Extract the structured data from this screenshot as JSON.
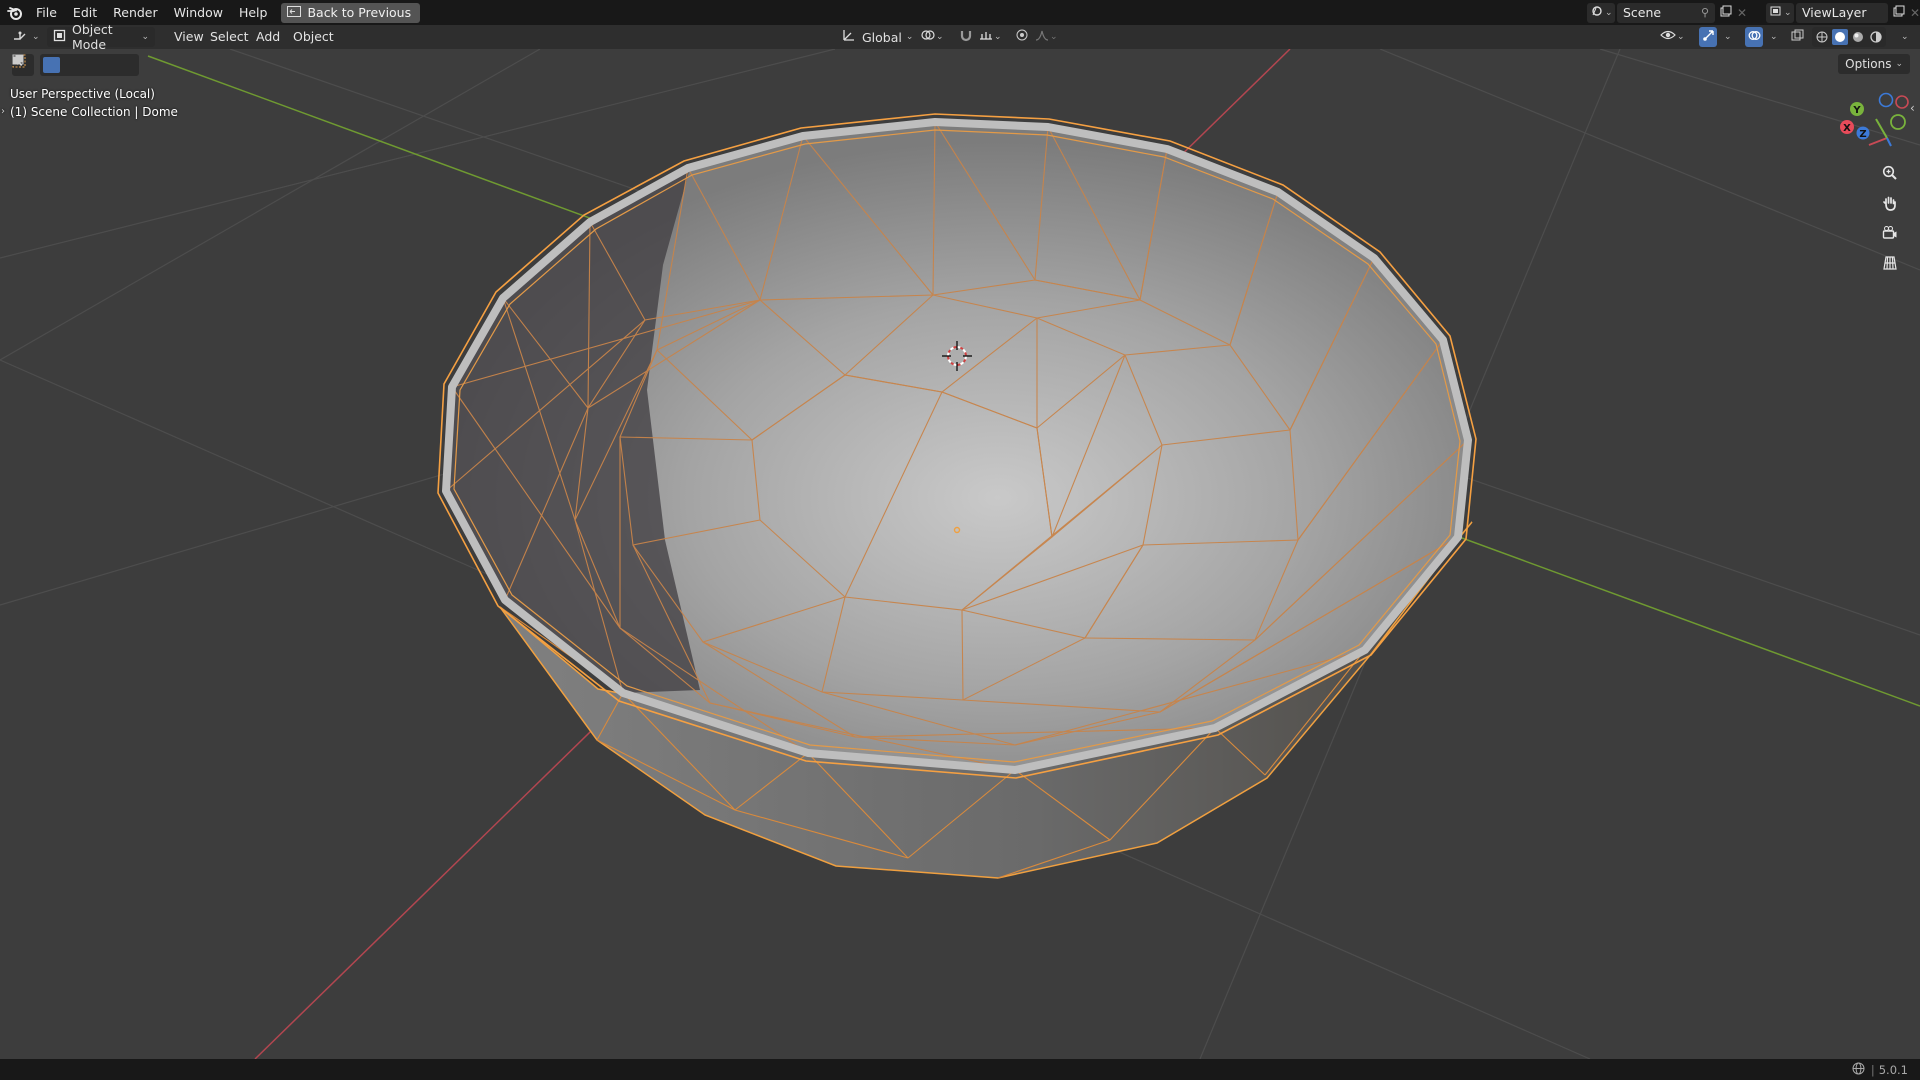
{
  "topbar": {
    "menus": [
      "File",
      "Edit",
      "Render",
      "Window",
      "Help"
    ],
    "back_button": "Back to Previous",
    "scene_name": "Scene",
    "view_layer_name": "ViewLayer"
  },
  "header": {
    "mode": "Object Mode",
    "menus": [
      "View",
      "Select",
      "Add",
      "Object"
    ],
    "transform_orientation": "Global",
    "options_label": "Options"
  },
  "viewport": {
    "perspective_label": "User Perspective (Local)",
    "collection_label": "(1) Scene Collection | Dome",
    "gizmo": {
      "x_label": "X",
      "y_label": "Y",
      "z_label": "Z"
    }
  },
  "statusbar": {
    "version": "5.0.1"
  },
  "colors": {
    "accent_blue": "#4772b3",
    "selection_orange": "#f5a042",
    "axis_x_red": "#c8424f",
    "axis_y_green": "#80b034",
    "axis_z_blue": "#3c7ad8"
  }
}
